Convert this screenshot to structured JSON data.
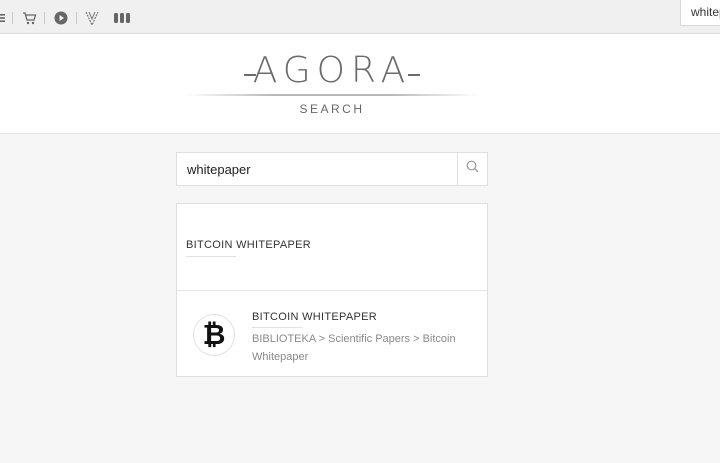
{
  "browser": {
    "search_text": "whitepaper",
    "icons": [
      "hamburger-icon",
      "cart-icon",
      "play-icon",
      "vivaldi-icon",
      "extensions-icon"
    ]
  },
  "header": {
    "logo_word": "AGORA",
    "logo_sub": "SEARCH"
  },
  "search": {
    "value": "whitepaper",
    "button_icon": "search-icon"
  },
  "results": {
    "category_title": "BITCOIN WHITEPAPER",
    "item": {
      "logo_glyph": "₿",
      "title": "BITCOIN WHITEPAPER",
      "path": "BIBLIOTEKA > Scientific Papers > Bitcoin Whitepaper"
    }
  },
  "colors": {
    "page_bg": "#f6f6f6",
    "panel_bg": "#ffffff",
    "border": "#dedede",
    "logo": "#6b6b6b",
    "muted_text": "#8a8a8a"
  }
}
